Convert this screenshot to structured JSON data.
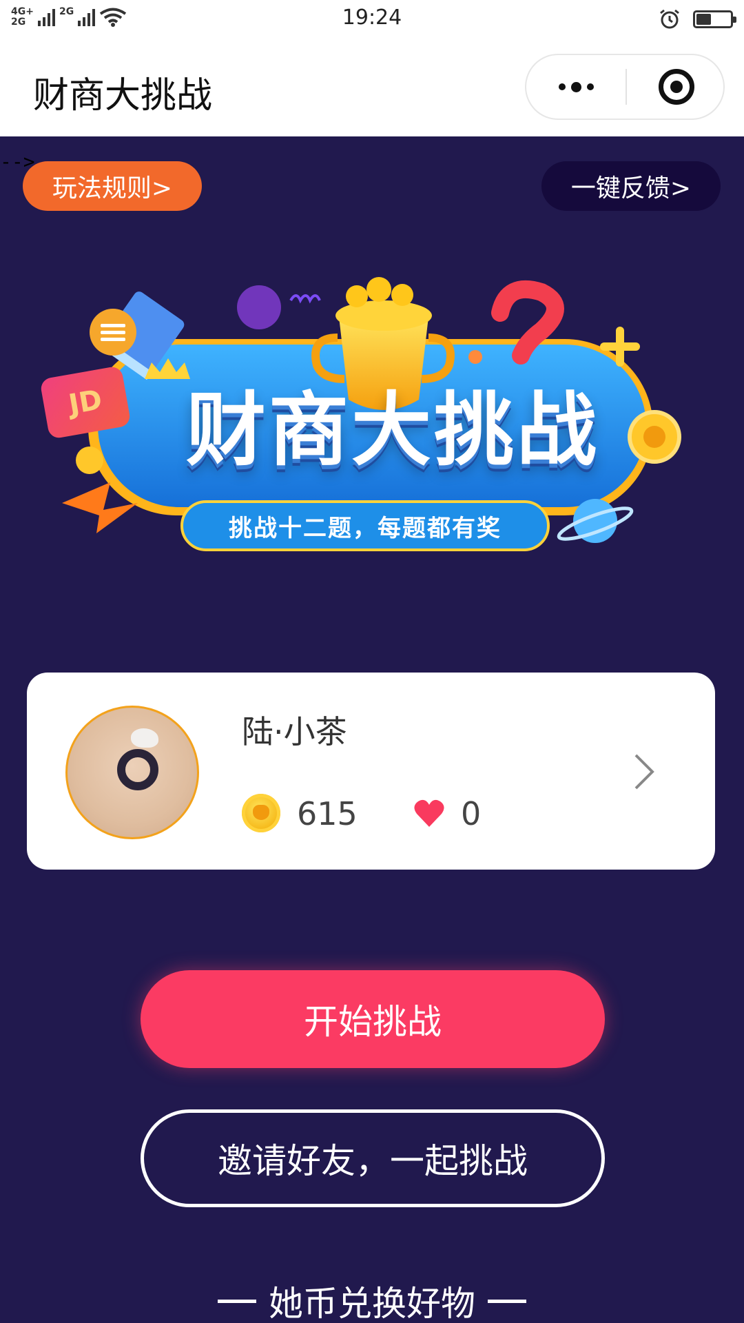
{
  "status_bar": {
    "network_top": "4G+",
    "network_bottom": "2G",
    "network_2g": "2G",
    "time": "19:24"
  },
  "title_bar": {
    "title": "财商大挑战"
  },
  "stray_text": "-->",
  "top_buttons": {
    "rules": "玩法规则>",
    "feedback": "一键反馈>"
  },
  "banner": {
    "title": "财商大挑战",
    "subtitle": "挑战十二题，每题都有奖",
    "badge": "JD"
  },
  "user": {
    "name": "陆·小茶",
    "coins": "615",
    "likes": "0"
  },
  "actions": {
    "start": "开始挑战",
    "invite": "邀请好友，一起挑战"
  },
  "exchange": {
    "heading": "她币兑换好物"
  },
  "colors": {
    "background": "#21194e",
    "rules_button": "#f2692b",
    "start_button": "#fb3b63",
    "feedback_button": "#150a3c"
  }
}
